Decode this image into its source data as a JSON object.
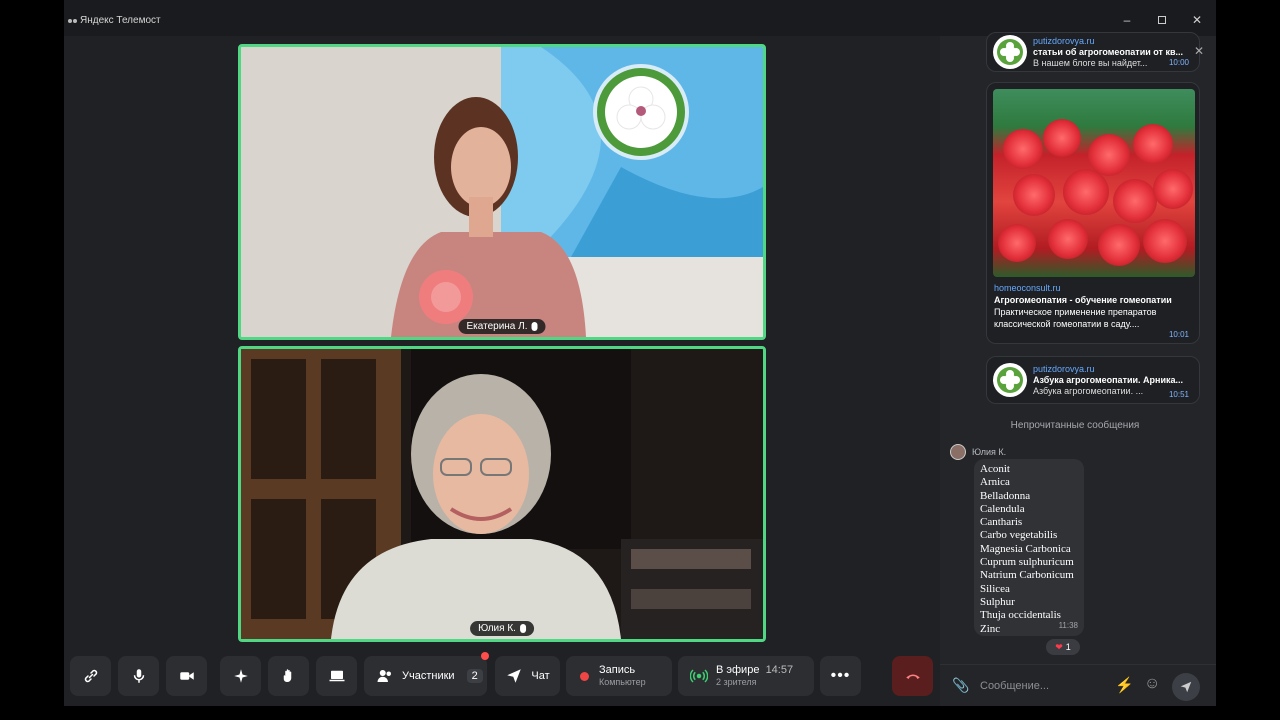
{
  "window": {
    "title": "Яндекс Телемост",
    "minimize": "–",
    "close": "✕"
  },
  "participants": [
    {
      "name": "Екатерина Л."
    },
    {
      "name": "Юлия К."
    }
  ],
  "toolbar": {
    "participants_label": "Участники",
    "participants_count": "2",
    "chat_label": "Чат",
    "record_label": "Запись",
    "record_sub": "Компьютер",
    "live_label": "В эфире",
    "live_time": "14:57",
    "live_viewers": "2 зрителя",
    "more": "•••"
  },
  "chat": {
    "messages": [
      {
        "source": "putizdorovya.ru",
        "title": "статьи об агрогомеопатии от кв...",
        "desc": "В нашем блоге вы найдет...",
        "time": "10:00"
      },
      {
        "source": "homeoconsult.ru",
        "title": "Агрогомеопатия - обучение гомеопатии",
        "desc1": "Практическое применение препаратов",
        "desc2": "классической гомеопатии в саду....",
        "time": "10:01"
      },
      {
        "source": "putizdorovya.ru",
        "title": "Азбука агрогомеопатии. Арника...",
        "desc": "Азбука агрогомеопатии. ...",
        "time": "10:51"
      }
    ],
    "unread_label": "Непрочитанные сообщения",
    "sender": "Юлия К.",
    "list": [
      "Aconit",
      "Arnica",
      "Belladonna",
      "Calendula",
      "Cantharis",
      "Carbo vegetabilis",
      "Magnesia Carbonica",
      "Cuprum sulphuricum",
      "Natrium Carbonicum",
      "Silicea",
      "Sulphur",
      "Thuja occidentalis",
      "Zinc"
    ],
    "list_time": "11:38",
    "reaction_count": "1",
    "input_placeholder": "Сообщение..."
  },
  "colors": {
    "speaking_border": "#4fd784",
    "link": "#66a9ff",
    "end_call": "#5a1e1e",
    "record_dot": "#f04545"
  }
}
